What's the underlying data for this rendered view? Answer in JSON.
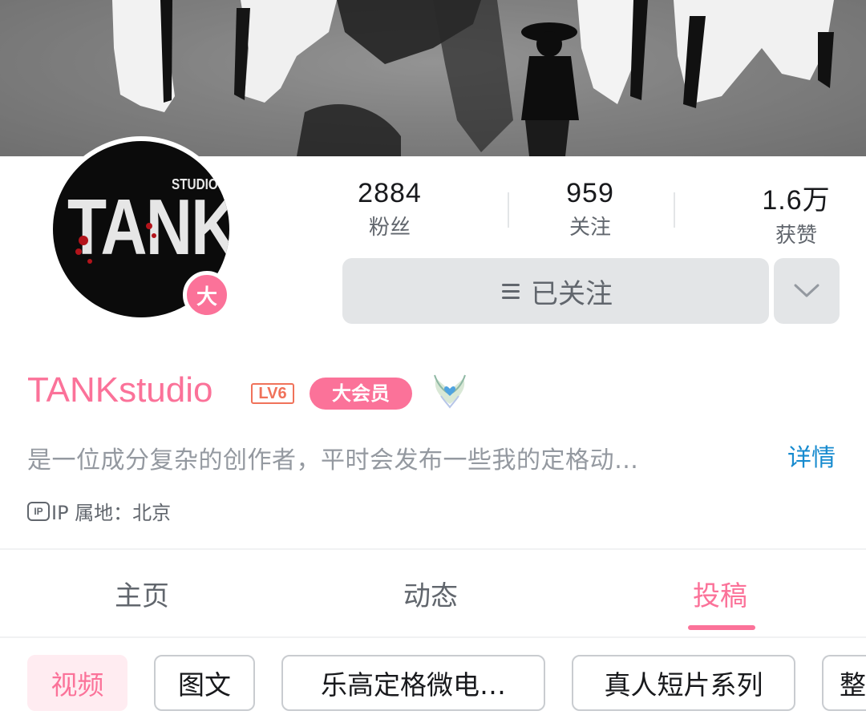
{
  "profile": {
    "avatar_text_small": "STUDIO",
    "avatar_text_big": "TANK",
    "vip_avatar_badge": "大",
    "username": "TANKstudio",
    "level": "LV6",
    "vip_label": "大会员",
    "pendant_icon": "heart-wings-icon",
    "bio": "是一位成分复杂的创作者，平时会发布一些我的定格动…",
    "details_link": "详情",
    "ip_icon_text": "IP",
    "ip_location": "IP 属地：北京"
  },
  "stats": [
    {
      "value": "2884",
      "label": "粉丝"
    },
    {
      "value": "959",
      "label": "关注"
    },
    {
      "value": "1.6万",
      "label": "获赞"
    }
  ],
  "actions": {
    "follow_label": "已关注",
    "more_icon": "chevron-down-icon"
  },
  "tabs": [
    {
      "label": "主页",
      "active": false
    },
    {
      "label": "动态",
      "active": false
    },
    {
      "label": "投稿",
      "active": true
    }
  ],
  "chips": [
    {
      "label": "视频",
      "active": true
    },
    {
      "label": "图文",
      "active": false
    },
    {
      "label": "乐高定格微电…",
      "active": false
    },
    {
      "label": "真人短片系列",
      "active": false
    },
    {
      "label": "整",
      "active": false
    }
  ],
  "colors": {
    "accent": "#fb7299",
    "link": "#178bcf",
    "level": "#f0725a",
    "muted_text": "#9499a0",
    "button_bg": "#e3e5e7"
  }
}
